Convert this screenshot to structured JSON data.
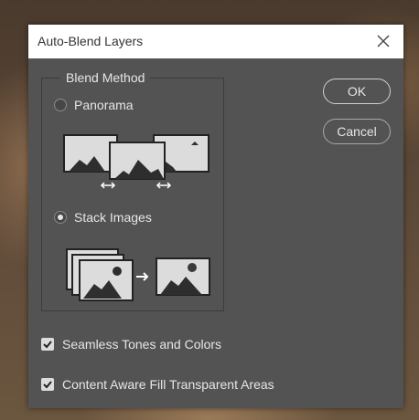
{
  "dialog": {
    "title": "Auto-Blend Layers",
    "close_icon": "close-icon"
  },
  "blend_method": {
    "legend": "Blend Method",
    "options": [
      {
        "label": "Panorama",
        "selected": false,
        "icon": "panorama-illustration"
      },
      {
        "label": "Stack Images",
        "selected": true,
        "icon": "stack-images-illustration"
      }
    ]
  },
  "buttons": {
    "ok": "OK",
    "cancel": "Cancel"
  },
  "checkboxes": [
    {
      "label": "Seamless Tones and Colors",
      "checked": true
    },
    {
      "label": "Content Aware Fill Transparent Areas",
      "checked": true
    }
  ],
  "colors": {
    "dialog_bg": "#535353",
    "text": "#e6e6e6",
    "titlebar": "#ffffff"
  }
}
